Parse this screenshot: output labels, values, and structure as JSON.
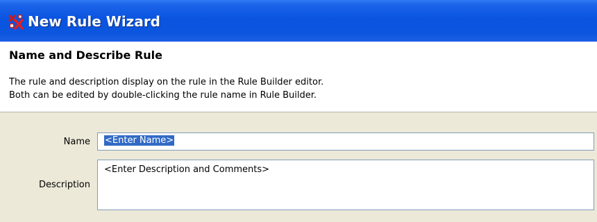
{
  "window": {
    "title": "New Rule Wizard",
    "icon": "rule-wizard-icon"
  },
  "header": {
    "title": "Name and Describe Rule",
    "description_lines": [
      "The rule and description display on the rule in the Rule Builder editor.",
      "Both can be edited by double-clicking the rule name in Rule Builder."
    ]
  },
  "form": {
    "name_label": "Name",
    "name_value": "<Enter Name>",
    "name_selected": true,
    "description_label": "Description",
    "description_value": "<Enter Description and Comments>"
  },
  "colors": {
    "titlebar": "#0a54e0",
    "dialog_background": "#ece9d8",
    "selection": "#316ac5",
    "input_border": "#7f9db9"
  }
}
